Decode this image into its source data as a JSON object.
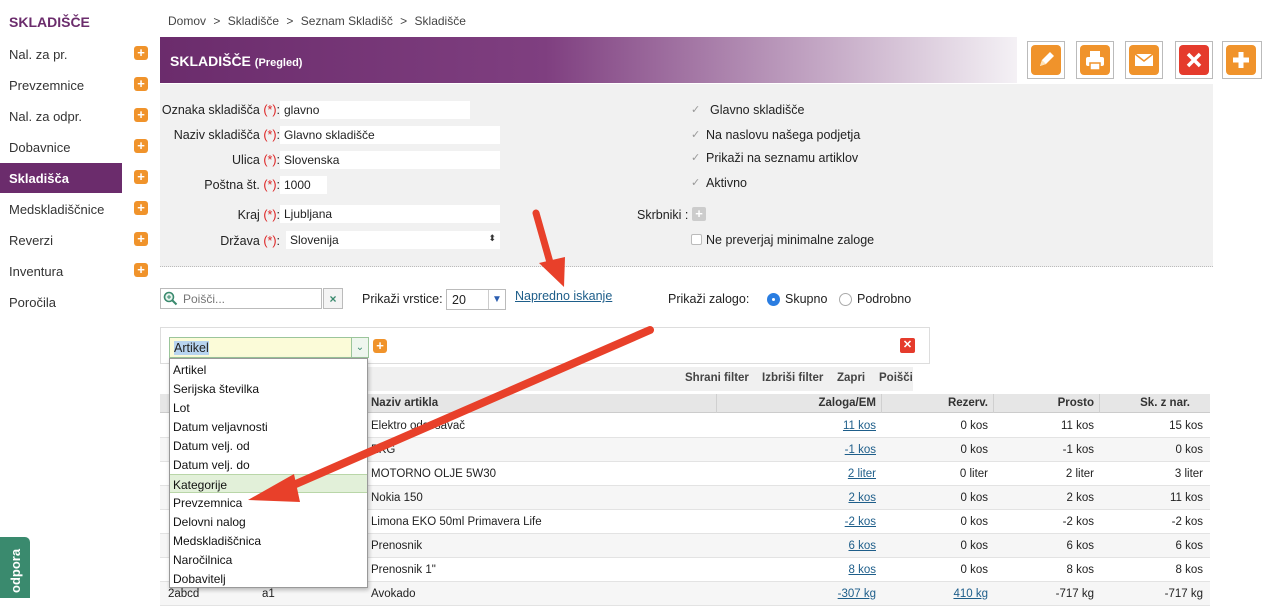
{
  "sidebar": {
    "brand": "SKLADIŠČE",
    "items": [
      {
        "label": "Nal. za pr.",
        "plus": "+"
      },
      {
        "label": "Prevzemnice",
        "plus": "+"
      },
      {
        "label": "Nal. za odpr.",
        "plus": "+"
      },
      {
        "label": "Dobavnice",
        "plus": "+"
      },
      {
        "label": "Skladišča",
        "plus": "+"
      },
      {
        "label": "Medskladiščnice",
        "plus": "+"
      },
      {
        "label": "Reverzi",
        "plus": "+"
      },
      {
        "label": "Inventura",
        "plus": "+"
      },
      {
        "label": "Poročila"
      }
    ],
    "support_label": "odpora"
  },
  "breadcrumb": [
    "Domov",
    ">",
    "Skladišče",
    ">",
    "Seznam Skladišč",
    ">",
    "Skladišče"
  ],
  "header": {
    "title": "SKLADIŠČE",
    "subtitle": "(Pregled)"
  },
  "form": {
    "labels": {
      "oznaka": "Oznaka skladišča",
      "naziv": "Naziv skladišča",
      "ulica": "Ulica",
      "postna": "Poštna št.",
      "kraj": "Kraj",
      "drzava": "Država",
      "req": "(*)",
      "colon": ":"
    },
    "values": {
      "oznaka": "glavno",
      "naziv": "Glavno skladišče",
      "ulica": "Slovenska",
      "postna": "1000",
      "kraj": "Ljubljana",
      "drzava": "Slovenija"
    },
    "checks": {
      "glavno": "Glavno skladišče",
      "naslov": "Na naslovu našega podjetja",
      "seznam": "Prikaži na seznamu artiklov",
      "aktivno": "Aktivno",
      "skrbniki": "Skrbniki :",
      "minimalne": "Ne preverjaj minimalne zaloge"
    }
  },
  "search": {
    "placeholder": "Poišči...",
    "rows_label": "Prikaži vrstice:",
    "rows_value": "20",
    "advanced": "Napredno iskanje",
    "stock_label": "Prikaži zalogo:",
    "radio_skupno": "Skupno",
    "radio_podrobno": "Podrobno"
  },
  "filter": {
    "selected": "Artikel",
    "actions": [
      "Shrani filter",
      "Izbriši filter",
      "Zapri",
      "Poišči"
    ],
    "options": [
      "Artikel",
      "Serijska številka",
      "Lot",
      "Datum veljavnosti",
      "Datum velj. od",
      "Datum velj. do",
      "Kategorije",
      "Prevzemnica",
      "Delovni nalog",
      "Medskladiščnica",
      "Naročilnica",
      "Dobavitelj"
    ]
  },
  "table": {
    "headers": [
      "Naziv artikla",
      "Zaloga/EM",
      "Rezerv.",
      "Prosto",
      "Sk. z nar."
    ],
    "rows": [
      {
        "code": "",
        "num": "",
        "name": "Elektro odsesavač",
        "zaloga": "11 kos",
        "rezerv": "0 kos",
        "prosto": "11 kos",
        "sknar": "15 kos"
      },
      {
        "code": "",
        "num": "",
        "name": "EKG",
        "zaloga": "-1 kos",
        "rezerv": "0 kos",
        "prosto": "-1 kos",
        "sknar": "0 kos"
      },
      {
        "code": "",
        "num": "",
        "name": "MOTORNO OLJE 5W30",
        "zaloga": "2 liter",
        "rezerv": "0 liter",
        "prosto": "2 liter",
        "sknar": "3 liter"
      },
      {
        "code": "",
        "num": "",
        "name": "Nokia 150",
        "zaloga": "2 kos",
        "rezerv": "0 kos",
        "prosto": "2 kos",
        "sknar": "11 kos"
      },
      {
        "code": "",
        "num": "",
        "name": "Limona EKO 50ml Primavera Life",
        "zaloga": "-2 kos",
        "rezerv": "0 kos",
        "prosto": "-2 kos",
        "sknar": "-2 kos"
      },
      {
        "code": "",
        "num": "",
        "name": "Prenosnik",
        "zaloga": "6 kos",
        "rezerv": "0 kos",
        "prosto": "6 kos",
        "sknar": "6 kos"
      },
      {
        "code": "",
        "num": "",
        "name": "Prenosnik 1\"",
        "zaloga": "8 kos",
        "rezerv": "0 kos",
        "prosto": "8 kos",
        "sknar": "8 kos"
      },
      {
        "code": "2abcd",
        "num": "a1",
        "name": "Avokado",
        "zaloga": "-307 kg",
        "rezerv": "410 kg",
        "prosto": "-717 kg",
        "sknar": "-717 kg"
      }
    ]
  },
  "colors": {
    "brand": "#6b2c6c",
    "orange": "#f0932b",
    "red": "#e53b2c",
    "arrow": "#e8402a"
  }
}
